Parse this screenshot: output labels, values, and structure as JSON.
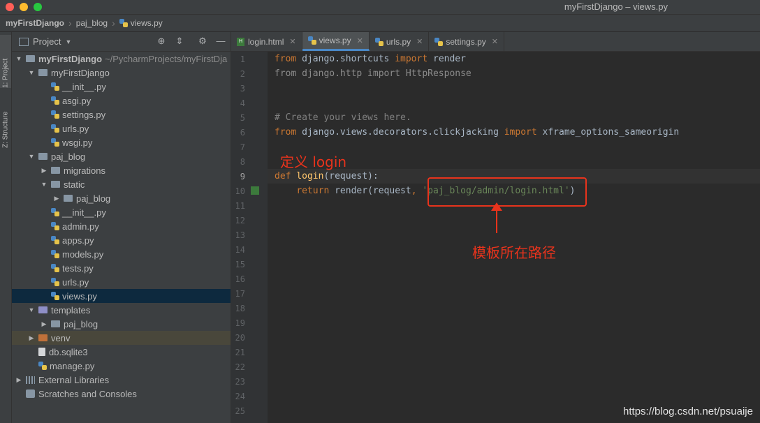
{
  "window": {
    "title": "myFirstDjango – views.py"
  },
  "breadcrumb": {
    "project": "myFirstDjango",
    "folder": "paj_blog",
    "file": "views.py"
  },
  "side_tabs": {
    "project": "1: Project",
    "structure": "Z: Structure"
  },
  "panel": {
    "title": "Project"
  },
  "tree": [
    {
      "label": "myFirstDjango",
      "extra": "~/PycharmProjects/myFirstDja",
      "kind": "folder",
      "indent": 0,
      "expanded": true,
      "bold": true
    },
    {
      "label": "myFirstDjango",
      "kind": "folder",
      "indent": 1,
      "expanded": true
    },
    {
      "label": "__init__.py",
      "kind": "py",
      "indent": 2
    },
    {
      "label": "asgi.py",
      "kind": "py",
      "indent": 2
    },
    {
      "label": "settings.py",
      "kind": "py",
      "indent": 2
    },
    {
      "label": "urls.py",
      "kind": "py",
      "indent": 2
    },
    {
      "label": "wsgi.py",
      "kind": "py",
      "indent": 2
    },
    {
      "label": "paj_blog",
      "kind": "folder",
      "indent": 1,
      "expanded": true
    },
    {
      "label": "migrations",
      "kind": "folder",
      "indent": 2,
      "expanded": false
    },
    {
      "label": "static",
      "kind": "folder",
      "indent": 2,
      "expanded": true
    },
    {
      "label": "paj_blog",
      "kind": "folder",
      "indent": 3,
      "expanded": false
    },
    {
      "label": "__init__.py",
      "kind": "py",
      "indent": 2
    },
    {
      "label": "admin.py",
      "kind": "py",
      "indent": 2
    },
    {
      "label": "apps.py",
      "kind": "py",
      "indent": 2
    },
    {
      "label": "models.py",
      "kind": "py",
      "indent": 2
    },
    {
      "label": "tests.py",
      "kind": "py",
      "indent": 2
    },
    {
      "label": "urls.py",
      "kind": "py",
      "indent": 2
    },
    {
      "label": "views.py",
      "kind": "py",
      "indent": 2,
      "selected": true
    },
    {
      "label": "templates",
      "kind": "folder-purple",
      "indent": 1,
      "expanded": true
    },
    {
      "label": "paj_blog",
      "kind": "folder",
      "indent": 2,
      "expanded": false
    },
    {
      "label": "venv",
      "kind": "folder-orange",
      "indent": 1,
      "expanded": false,
      "highlight": true
    },
    {
      "label": "db.sqlite3",
      "kind": "file",
      "indent": 1
    },
    {
      "label": "manage.py",
      "kind": "py",
      "indent": 1
    },
    {
      "label": "External Libraries",
      "kind": "lib",
      "indent": 0,
      "expanded": false
    },
    {
      "label": "Scratches and Consoles",
      "kind": "scratch",
      "indent": 0
    }
  ],
  "tabs": [
    {
      "label": "login.html",
      "icon": "html",
      "active": false
    },
    {
      "label": "views.py",
      "icon": "py",
      "active": true
    },
    {
      "label": "urls.py",
      "icon": "py",
      "active": false
    },
    {
      "label": "settings.py",
      "icon": "py",
      "active": false
    }
  ],
  "line_numbers": [
    "1",
    "2",
    "3",
    "4",
    "5",
    "6",
    "7",
    "8",
    "9",
    "10",
    "11",
    "12",
    "13",
    "14",
    "15",
    "16",
    "17",
    "18",
    "19",
    "20",
    "21",
    "22",
    "23",
    "24",
    "25"
  ],
  "code": {
    "l1": {
      "k1": "from",
      "m1": " django.shortcuts ",
      "k2": "import",
      "m2": " render"
    },
    "l2": "from django.http import HttpResponse",
    "l5": "# Create your views here.",
    "l6": {
      "k1": "from",
      "m1": " django.views.decorators.clickjacking ",
      "k2": "import",
      "m2": " xframe_options_sameorigin"
    },
    "l9": {
      "k1": "def",
      "fn": " login",
      "rest": "(request):"
    },
    "l10": {
      "k1": "return",
      "m1": " render(request",
      "comma": ",",
      "sp": " ",
      "str": "'paj_blog/admin/login.html'",
      "end": ")"
    }
  },
  "annotations": {
    "define_login": "定义 login",
    "template_path": "模板所在路径"
  },
  "watermark": "https://blog.csdn.net/psuaije"
}
